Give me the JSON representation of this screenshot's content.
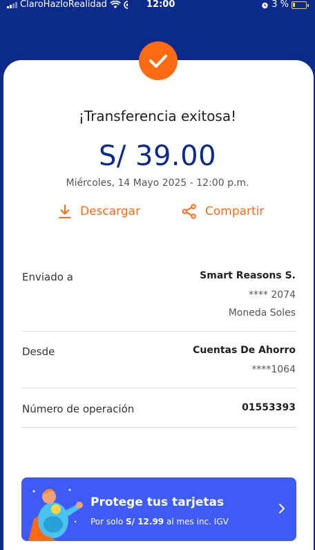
{
  "status_bar": {
    "carrier": "ClaroHazloRealidad",
    "time": "12:00",
    "battery": "3 %"
  },
  "receipt": {
    "title": "¡Transferencia exitosa!",
    "amount": "S/ 39.00",
    "datetime": "Miércoles, 14 Mayo 2025 - 12:00 p.m."
  },
  "actions": {
    "download": "Descargar",
    "share": "Compartir"
  },
  "details": {
    "sent_to": {
      "label": "Enviado a",
      "name": "Smart Reasons S.",
      "account": "**** 2074",
      "currency": "Moneda Soles"
    },
    "from": {
      "label": "Desde",
      "name": "Cuentas De Ahorro",
      "account": "****1064"
    },
    "operation": {
      "label": "Número de operación",
      "value": "01553393"
    }
  },
  "promo": {
    "title": "Protege tus tarjetas",
    "sub_prefix": "Por solo ",
    "sub_price": "S/ 12.99",
    "sub_suffix": " al mes inc. IGV"
  },
  "colors": {
    "header_blue": "#0b2a8a",
    "accent_orange": "#ff6a13",
    "promo_blue": "#3e5cf5"
  }
}
